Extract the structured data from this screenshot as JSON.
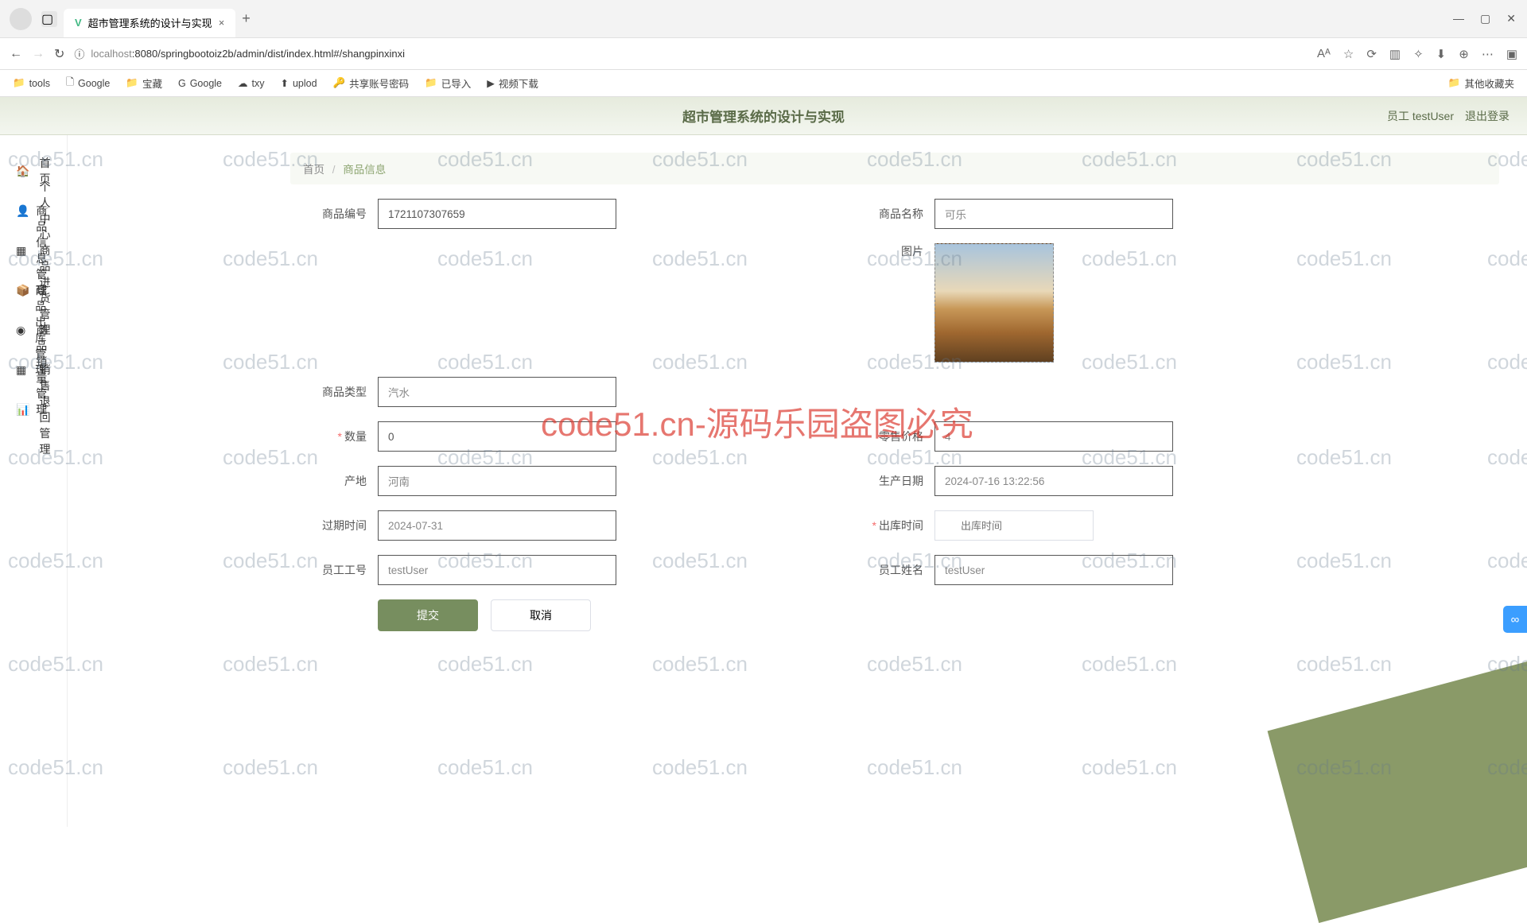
{
  "browser": {
    "tab_title": "超市管理系统的设计与实现",
    "url_host": "localhost",
    "url_path": ":8080/springbootoiz2b/admin/dist/index.html#/shangpinxinxi",
    "bookmarks": [
      "tools",
      "Google",
      "宝藏",
      "Google",
      "txy",
      "uplod",
      "共享账号密码",
      "已导入",
      "视频下载"
    ],
    "other_bookmarks": "其他收藏夹"
  },
  "header": {
    "title": "超市管理系统的设计与实现",
    "user_label": "员工 testUser",
    "logout": "退出登录"
  },
  "sidebar": {
    "items": [
      {
        "label": "首页"
      },
      {
        "label": "个人中心"
      },
      {
        "label": "商品信息管理"
      },
      {
        "label": "商品进货管理"
      },
      {
        "label": "商品出库管理"
      },
      {
        "label": "商品销量管理"
      },
      {
        "label": "销售退回管理"
      }
    ]
  },
  "breadcrumb": {
    "home": "首页",
    "current": "商品信息"
  },
  "form": {
    "product_code": {
      "label": "商品编号",
      "value": "1721107307659"
    },
    "product_name": {
      "label": "商品名称",
      "value": "可乐"
    },
    "image": {
      "label": "图片"
    },
    "product_type": {
      "label": "商品类型",
      "value": "汽水"
    },
    "quantity": {
      "label": "数量",
      "value": "0",
      "required": true
    },
    "retail_price": {
      "label": "零售价格",
      "value": "4"
    },
    "origin": {
      "label": "产地",
      "value": "河南"
    },
    "prod_date": {
      "label": "生产日期",
      "value": "2024-07-16 13:22:56"
    },
    "expire": {
      "label": "过期时间",
      "value": "2024-07-31"
    },
    "out_time": {
      "label": "出库时间",
      "placeholder": "出库时间",
      "required": true
    },
    "emp_id": {
      "label": "员工工号",
      "value": "testUser"
    },
    "emp_name": {
      "label": "员工姓名",
      "value": "testUser"
    }
  },
  "buttons": {
    "submit": "提交",
    "cancel": "取消"
  },
  "watermark": {
    "text": "code51.cn",
    "big": "code51.cn-源码乐园盗图必究"
  }
}
